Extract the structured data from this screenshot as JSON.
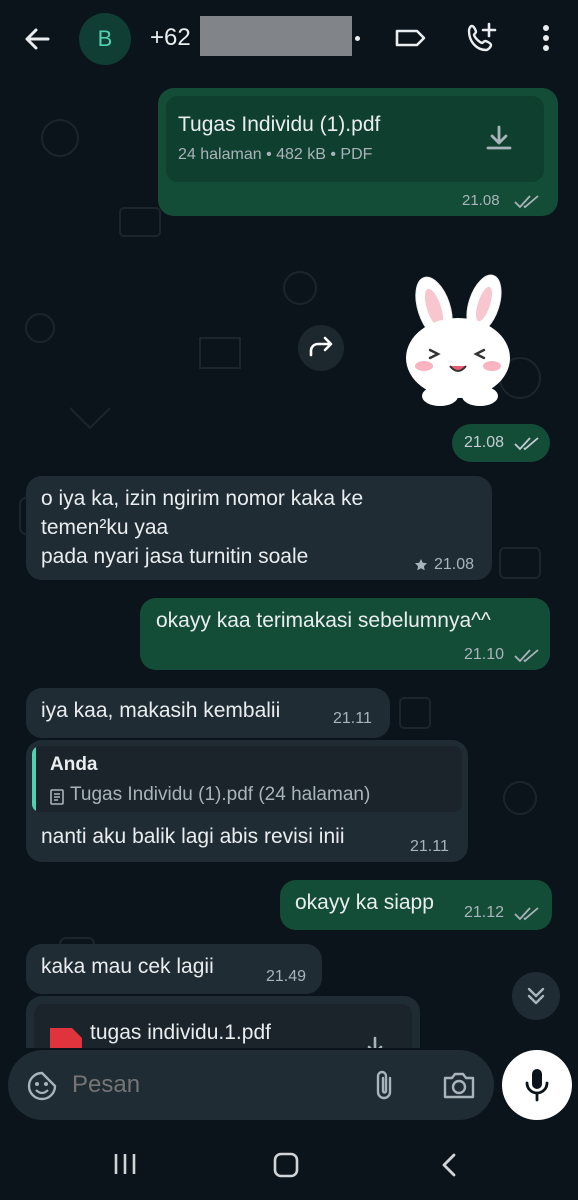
{
  "header": {
    "avatar_letter": "B",
    "contact_prefix": "+62"
  },
  "messages": [
    {
      "type": "document",
      "direction": "out",
      "file_name": "Tugas Individu (1).pdf",
      "file_meta": "24 halaman • 482 kB • PDF",
      "time": "21.08"
    },
    {
      "type": "sticker",
      "direction": "out",
      "time": "21.08"
    },
    {
      "type": "text",
      "direction": "in",
      "text": "o iya ka, izin ngirim nomor kaka ke\ntemen²ku yaa\npada nyari jasa turnitin soale",
      "time": "21.08",
      "starred": true
    },
    {
      "type": "text",
      "direction": "out",
      "text": "okayy kaa terimakasi sebelumnya^^",
      "time": "21.10"
    },
    {
      "type": "text",
      "direction": "in",
      "text": "iya kaa, makasih kembalii",
      "time": "21.11"
    },
    {
      "type": "reply",
      "direction": "in",
      "quote_author": "Anda",
      "quote_text": "Tugas Individu (1).pdf (24 halaman)",
      "text": "nanti aku balik lagi abis revisi inii",
      "time": "21.11"
    },
    {
      "type": "text",
      "direction": "out",
      "text": "okayy ka siapp",
      "time": "21.12"
    },
    {
      "type": "text",
      "direction": "in",
      "text": "kaka  mau cek lagii",
      "time": "21.49"
    },
    {
      "type": "document",
      "direction": "in",
      "file_name": "tugas individu.1.pdf"
    }
  ],
  "composer": {
    "placeholder": "Pesan"
  },
  "icons": {
    "back": "arrow-left-icon",
    "label": "label-icon",
    "add_call": "add-call-icon",
    "menu": "more-vert-icon",
    "download": "download-icon",
    "forward": "forward-icon",
    "emoji": "sticker-icon",
    "attach": "paperclip-icon",
    "camera": "camera-icon",
    "mic": "mic-icon",
    "scroll_down": "double-chevron-down-icon"
  },
  "colors": {
    "background": "#0b141a",
    "outgoing_bubble": "#144d37",
    "incoming_bubble": "#202c33",
    "read_ticks": "#a9b4ba",
    "quote_bar": "#4fd1b1"
  }
}
